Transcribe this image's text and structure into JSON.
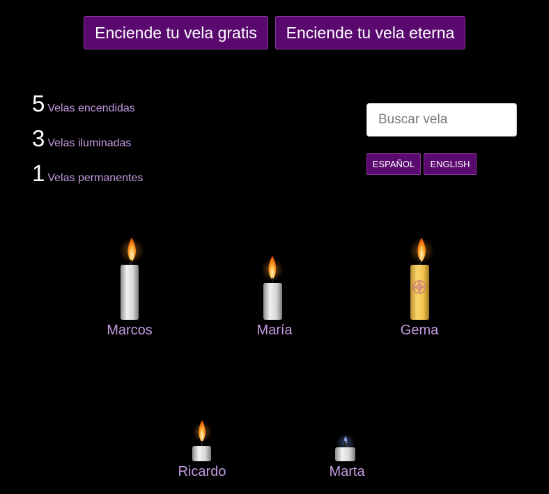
{
  "header": {
    "free_candle_button": "Enciende tu vela gratis",
    "eternal_candle_button": "Enciende tu vela eterna"
  },
  "stats": [
    {
      "count": "5",
      "label": "Velas encendidas"
    },
    {
      "count": "3",
      "label": "Velas iluminadas"
    },
    {
      "count": "1",
      "label": "Velas permanentes"
    }
  ],
  "search": {
    "placeholder": "Buscar vela",
    "value": ""
  },
  "languages": {
    "spanish": "ESPAÑOL",
    "english": "ENGLISH"
  },
  "candles": [
    {
      "name": "Marcos",
      "style": "tall-white",
      "lit": true
    },
    {
      "name": "María",
      "style": "short-white",
      "lit": true
    },
    {
      "name": "Gema",
      "style": "yellow-decorated",
      "lit": true
    },
    {
      "name": "Ricardo",
      "style": "small-white",
      "lit": true
    },
    {
      "name": "Marta",
      "style": "melted-white",
      "lit": false
    }
  ],
  "colors": {
    "background": "#000000",
    "button_purple": "#5a0a6e",
    "label_lavender": "#c39be0"
  }
}
